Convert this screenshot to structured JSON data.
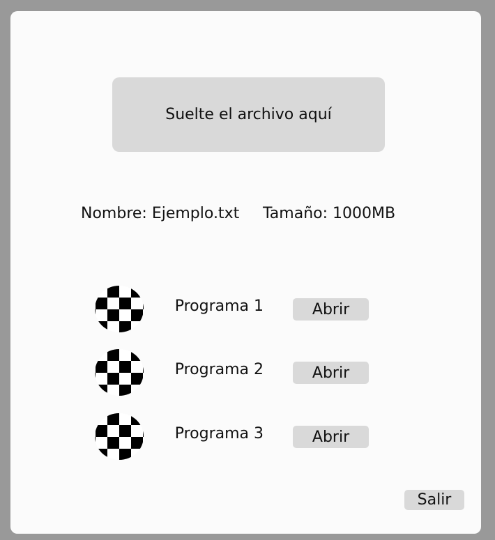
{
  "dropzone": {
    "label": "Suelte el archivo aquí"
  },
  "file": {
    "name_text": "Nombre: Ejemplo.txt",
    "size_text": "Tamaño: 1000MB"
  },
  "programs": [
    {
      "label": "Programa 1",
      "open_label": "Abrir",
      "icon": "checkered-circle-icon"
    },
    {
      "label": "Programa 2",
      "open_label": "Abrir",
      "icon": "checkered-circle-icon"
    },
    {
      "label": "Programa 3",
      "open_label": "Abrir",
      "icon": "checkered-circle-icon"
    }
  ],
  "footer": {
    "exit_label": "Salir"
  },
  "colors": {
    "backdrop": "#999999",
    "window": "#fbfbfb",
    "control": "#d9d9d9",
    "text": "#111111"
  }
}
